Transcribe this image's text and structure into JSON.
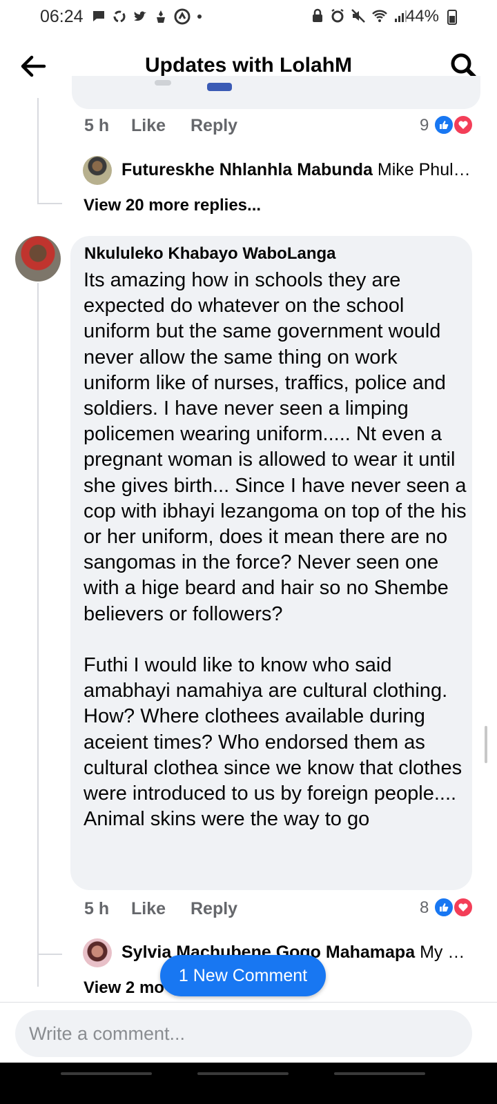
{
  "status_bar": {
    "time": "06:24",
    "battery": "44%"
  },
  "header": {
    "title": "Updates with LolahM"
  },
  "previous_comment": {
    "time": "5 h",
    "like": "Like",
    "reply": "Reply",
    "reaction_count": "9",
    "reply_preview": {
      "name": "Futureskhe Nhlanhla Mabunda",
      "snippet": "Mike Phula..."
    },
    "view_more": "View 20 more replies..."
  },
  "comment": {
    "author": "Nkululeko Khabayo WaboLanga",
    "paragraph1": "Its amazing how in schools they are expected do whatever on the school uniform but the same government would never allow the same thing on work uniform like of nurses, traffics, police and soldiers. I have never seen a limping policemen wearing uniform..... Nt even a pregnant woman is allowed to wear it until she gives birth... Since I have never seen a cop with ibhayi lezangoma on top of the his or her uniform, does it mean there are no sangomas in the force? Never seen one with a hige beard and hair so no Shembe believers or followers?",
    "paragraph2": "Futhi I would like to know who said amabhayi namahiya are cultural clothing. How? Where clothees available during aceient times? Who endorsed them as cultural clothea since we know that clothes were introduced to us by foreign people.... Animal skins were the way to go",
    "time": "5 h",
    "like": "Like",
    "reply": "Reply",
    "reaction_count": "8",
    "reply_preview": {
      "name": "Sylvia Machubene Gogo Mahamapa",
      "snippet": "My br..."
    },
    "view_more": "View 2 mo"
  },
  "new_comment_pill": "1 New Comment",
  "composer": {
    "placeholder": "Write a comment..."
  }
}
